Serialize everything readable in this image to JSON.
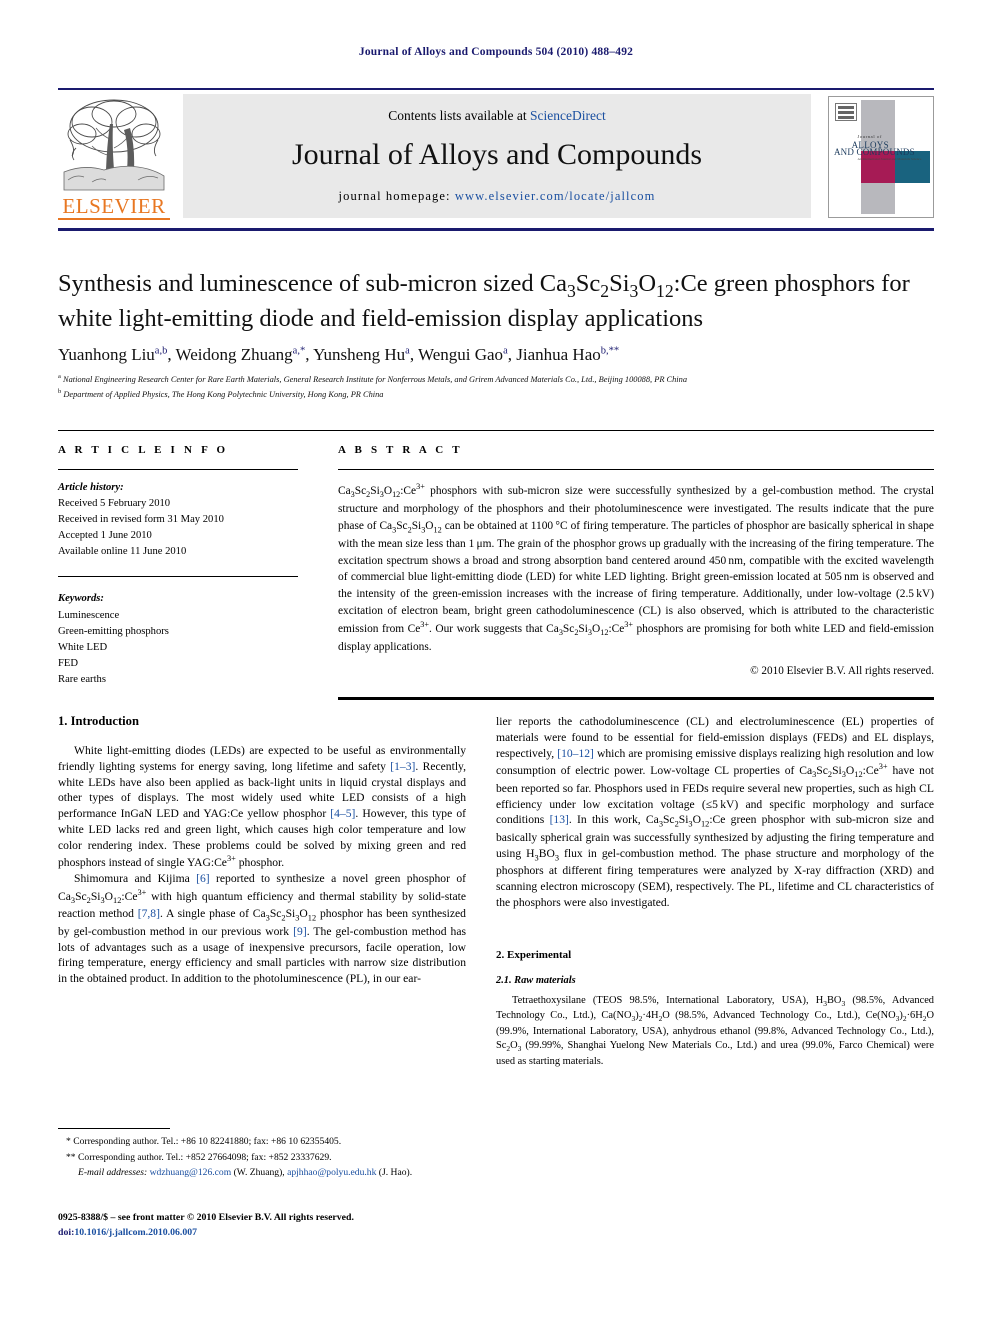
{
  "running_head": "Journal of Alloys and Compounds 504 (2010) 488–492",
  "masthead": {
    "contents_label": "Contents lists available at",
    "contents_link": "ScienceDirect",
    "journal_title": "Journal of Alloys and Compounds",
    "homepage_label": "journal homepage:",
    "homepage_url": "www.elsevier.com/locate/jallcom",
    "publisher_name": "ELSEVIER",
    "cover": {
      "line1": "Journal of",
      "line2": "ALLOYS",
      "line3": "AND COMPOUNDS",
      "line4": "An International Journal\nand Materials Science"
    },
    "colors": {
      "elsevier_orange": "#E87722",
      "link_blue": "#1a4fa0",
      "rule_navy": "#1a1a6e",
      "cover_magenta": "#a61b55",
      "cover_teal": "#19637f"
    }
  },
  "article": {
    "title": "Synthesis and luminescence of sub-micron sized Ca3Sc2Si3O12:Ce green phosphors for white light-emitting diode and field-emission display applications",
    "authors_html": "Yuanhong Liu<sup>a,b</sup>, Weidong Zhuang<sup>a,</sup><sup>*</sup>, Yunsheng Hu<sup>a</sup>, Wengui Gao<sup>a</sup>, Jianhua Hao<sup>b,</sup><sup>**</sup>",
    "affiliations": [
      "a National Engineering Research Center for Rare Earth Materials, General Research Institute for Nonferrous Metals, and Grirem Advanced Materials Co., Ltd., Beijing 100088, PR China",
      "b Department of Applied Physics, The Hong Kong Polytechnic University, Hong Kong, PR China"
    ]
  },
  "article_info": {
    "heading": "A R T I C L E    I N F O",
    "history_label": "Article history:",
    "history": [
      "Received 5 February 2010",
      "Received in revised form 31 May 2010",
      "Accepted 1 June 2010",
      "Available online 11 June 2010"
    ],
    "keywords_label": "Keywords:",
    "keywords": [
      "Luminescence",
      "Green-emitting phosphors",
      "White LED",
      "FED",
      "Rare earths"
    ]
  },
  "abstract": {
    "heading": "A B S T R A C T",
    "text": "Ca3Sc2Si3O12:Ce3+ phosphors with sub-micron size were successfully synthesized by a gel-combustion method. The crystal structure and morphology of the phosphors and their photoluminescence were investigated. The results indicate that the pure phase of Ca3Sc2Si3O12 can be obtained at 1100 °C of firing temperature. The particles of phosphor are basically spherical in shape with the mean size less than 1 μm. The grain of the phosphor grows up gradually with the increasing of the firing temperature. The excitation spectrum shows a broad and strong absorption band centered around 450 nm, compatible with the excited wavelength of commercial blue light-emitting diode (LED) for white LED lighting. Bright green-emission located at 505 nm is observed and the intensity of the green-emission increases with the increase of firing temperature. Additionally, under low-voltage (2.5 kV) excitation of electron beam, bright green cathodoluminescence (CL) is also observed, which is attributed to the characteristic emission from Ce3+. Our work suggests that Ca3Sc2Si3O12:Ce3+ phosphors are promising for both white LED and field-emission display applications.",
    "copyright": "© 2010 Elsevier B.V. All rights reserved."
  },
  "sections": {
    "intro_heading": "1. Introduction",
    "intro_p1": "White light-emitting diodes (LEDs) are expected to be useful as environmentally friendly lighting systems for energy saving, long lifetime and safety [1–3]. Recently, white LEDs have also been applied as back-light units in liquid crystal displays and other types of displays. The most widely used white LED consists of a high performance InGaN LED and YAG:Ce yellow phosphor [4–5]. However, this type of white LED lacks red and green light, which causes high color temperature and low color rendering index. These problems could be solved by mixing green and red phosphors instead of single YAG:Ce3+ phosphor.",
    "intro_p2": "Shimomura and Kijima [6] reported to synthesize a novel green phosphor of Ca3Sc2Si3O12:Ce3+ with high quantum efficiency and thermal stability by solid-state reaction method [7,8]. A single phase of Ca3Sc2Si3O12 phosphor has been synthesized by gel-combustion method in our previous work [9]. The gel-combustion method has lots of advantages such as a usage of inexpensive precursors, facile operation, low firing temperature, energy efficiency and small particles with narrow size distribution in the obtained product. In addition to the photoluminescence (PL), in our ear-",
    "intro_p2_cont": "lier reports the cathodoluminescence (CL) and electroluminescence (EL) properties of materials were found to be essential for field-emission displays (FEDs) and EL displays, respectively, [10–12] which are promising emissive displays realizing high resolution and low consumption of electric power. Low-voltage CL properties of Ca3Sc2Si3O12:Ce3+ have not been reported so far. Phosphors used in FEDs require several new properties, such as high CL efficiency under low excitation voltage (≤5 kV) and specific morphology and surface conditions [13]. In this work, Ca3Sc2Si3O12:Ce green phosphor with sub-micron size and basically spherical grain was successfully synthesized by adjusting the firing temperature and using H3BO3 flux in gel-combustion method. The phase structure and morphology of the phosphors at different firing temperatures were analyzed by X-ray diffraction (XRD) and scanning electron microscopy (SEM), respectively. The PL, lifetime and CL characteristics of the phosphors were also investigated.",
    "exp_heading": "2. Experimental",
    "raw_heading": "2.1. Raw materials",
    "raw_p1": "Tetraethoxysilane (TEOS 98.5%, International Laboratory, USA), H3BO3 (98.5%, Advanced Technology Co., Ltd.), Ca(NO3)2·4H2O (98.5%, Advanced Technology Co., Ltd.), Ce(NO3)2·6H2O (99.9%, International Laboratory, USA), anhydrous ethanol (99.8%, Advanced Technology Co., Ltd.), Sc2O3 (99.99%, Shanghai Yuelong New Materials Co., Ltd.) and urea (99.0%, Farco Chemical) were used as starting materials."
  },
  "footnotes": {
    "note1": "* Corresponding author. Tel.: +86 10 82241880; fax: +86 10 62355405.",
    "note2": "** Corresponding author. Tel.: +852 27664098; fax: +852 23337629.",
    "email_label": "E-mail addresses:",
    "email1": "wdzhuang@126.com",
    "email1_who": "(W. Zhuang),",
    "email2": "apjhhao@polyu.edu.hk",
    "email2_who": "(J. Hao)."
  },
  "footer": {
    "issn_line": "0925-8388/$ – see front matter © 2010 Elsevier B.V. All rights reserved.",
    "doi_label": "doi:",
    "doi_value": "10.1016/j.jallcom.2010.06.007"
  }
}
